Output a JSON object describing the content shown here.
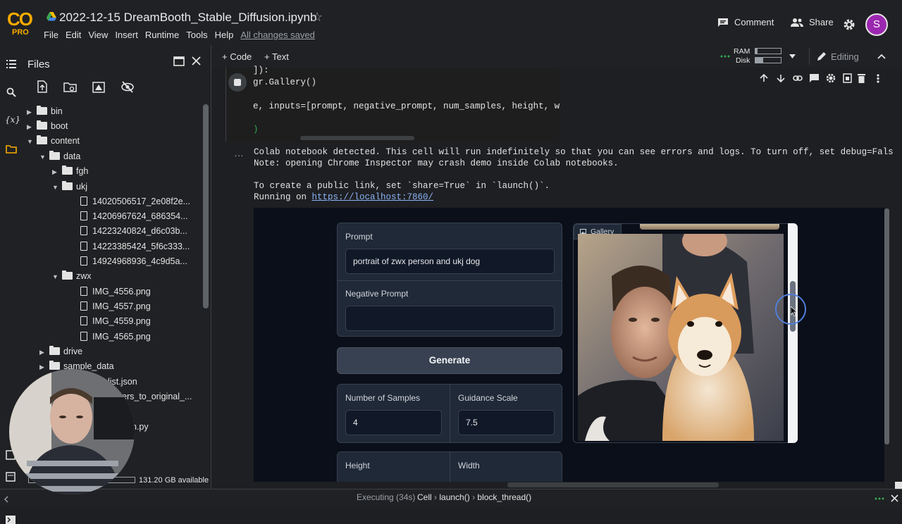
{
  "header": {
    "logo_text": "CO",
    "logo_sub": "PRO",
    "title": "2022-12-15 DreamBooth_Stable_Diffusion.ipynb",
    "menu": [
      "File",
      "Edit",
      "View",
      "Insert",
      "Runtime",
      "Tools",
      "Help"
    ],
    "saved_status": "All changes saved",
    "comment_label": "Comment",
    "share_label": "Share",
    "avatar_letter": "S"
  },
  "files": {
    "title": "Files",
    "tree": [
      {
        "label": "bin",
        "type": "folder",
        "depth": 0,
        "state": "collapsed"
      },
      {
        "label": "boot",
        "type": "folder",
        "depth": 0,
        "state": "collapsed"
      },
      {
        "label": "content",
        "type": "folder",
        "depth": 0,
        "state": "expanded"
      },
      {
        "label": "data",
        "type": "folder",
        "depth": 1,
        "state": "expanded"
      },
      {
        "label": "fgh",
        "type": "folder",
        "depth": 2,
        "state": "collapsed"
      },
      {
        "label": "ukj",
        "type": "folder",
        "depth": 2,
        "state": "expanded"
      },
      {
        "label": "14020506517_2e08f2e...",
        "type": "file",
        "depth": 3
      },
      {
        "label": "14206967624_686354...",
        "type": "file",
        "depth": 3
      },
      {
        "label": "14223240824_d6c03b...",
        "type": "file",
        "depth": 3
      },
      {
        "label": "14223385424_5f6c333...",
        "type": "file",
        "depth": 3
      },
      {
        "label": "14924968936_4c9d5a...",
        "type": "file",
        "depth": 3
      },
      {
        "label": "zwx",
        "type": "folder",
        "depth": 2,
        "state": "expanded"
      },
      {
        "label": "IMG_4556.png",
        "type": "file",
        "depth": 3
      },
      {
        "label": "IMG_4557.png",
        "type": "file",
        "depth": 3
      },
      {
        "label": "IMG_4559.png",
        "type": "file",
        "depth": 3
      },
      {
        "label": "IMG_4565.png",
        "type": "file",
        "depth": 3
      },
      {
        "label": "drive",
        "type": "folder",
        "depth": 1,
        "state": "collapsed"
      },
      {
        "label": "sample_data",
        "type": "folder",
        "depth": 1,
        "state": "collapsed"
      }
    ],
    "partial_items": [
      "list.json",
      "ers_to_original_...",
      "n.py"
    ],
    "disk_available": "131.20 GB available"
  },
  "toolbar": {
    "add_code": "+ Code",
    "add_text": "+ Text",
    "ram_label": "RAM",
    "disk_label": "Disk",
    "ram_fraction": 0.08,
    "disk_fraction": 0.3,
    "editing_label": "Editing"
  },
  "code_cell": {
    "lines": [
      "]):",
      "gr.Gallery()",
      "",
      "e, inputs=[prompt, negative_prompt, num_samples, height, w",
      "",
      ")"
    ]
  },
  "output": {
    "line1": "Colab notebook detected. This cell will run indefinitely so that you can see errors and logs. To turn off, set debug=Fals",
    "line2": "Note: opening Chrome Inspector may crash demo inside Colab notebooks.",
    "line3": "To create a public link, set `share=True` in `launch()`.",
    "line4_prefix": "Running on ",
    "line4_link": "https://localhost:7860/"
  },
  "gradio": {
    "prompt_label": "Prompt",
    "prompt_value": "portrait of zwx person and ukj dog",
    "negative_label": "Negative Prompt",
    "negative_value": "",
    "generate_label": "Generate",
    "samples_label": "Number of Samples",
    "samples_value": "4",
    "guidance_label": "Guidance Scale",
    "guidance_value": "7.5",
    "height_label": "Height",
    "width_label": "Width",
    "gallery_label": "Gallery"
  },
  "status": {
    "executing": "Executing (34s)",
    "crumbs": [
      "Cell",
      "launch()",
      "block_thread()"
    ]
  },
  "colors": {
    "accent_orange": "#f9ab00",
    "avatar_purple": "#9c27b0",
    "link_blue": "#8ab4f8",
    "gradio_bg": "#0b0f19"
  }
}
